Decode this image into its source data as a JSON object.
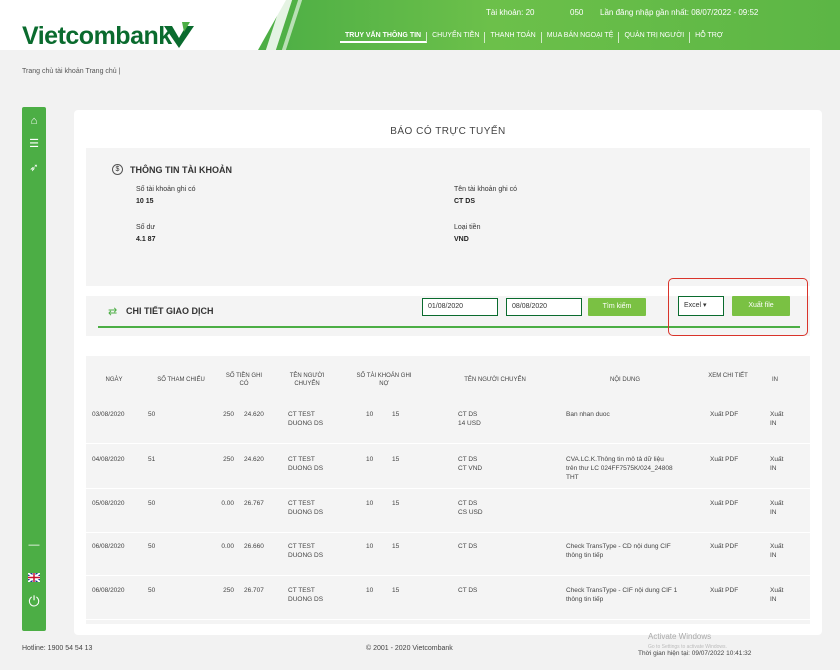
{
  "header": {
    "brand": "Vietcombank",
    "info": [
      "Tài khoản: 20",
      "050",
      "Lần đăng nhập gần nhất: 08/07/2022 - 09:52"
    ],
    "nav": [
      "TRUY VẤN THÔNG TIN",
      "CHUYỂN TIỀN",
      "THANH TOÁN",
      "MUA BÁN NGOẠI TỆ",
      "QUẢN TRỊ NGƯỜI",
      "HỖ TRỢ"
    ]
  },
  "breadcrumb": "Trang chủ tài khoản   Trang chủ |",
  "report_title": "BÁO CÓ TRỰC TUYẾN",
  "account": {
    "title": "THÔNG TIN TÀI KHOẢN",
    "fields": [
      {
        "label": "Số tài khoản ghi có",
        "value": "10          15"
      },
      {
        "label": "Tên tài khoản ghi có",
        "value": "CT                 DS"
      },
      {
        "label": "Số dư",
        "value": "4.1            87"
      },
      {
        "label": "Loại tiền",
        "value": "VND"
      }
    ]
  },
  "transactions": {
    "title": "CHI TIẾT GIAO DỊCH",
    "from_date": "01/08/2020",
    "to_date": "08/08/2020",
    "search_label": "Tìm kiếm",
    "export_format": "Excel ▾",
    "export_label": "Xuất file"
  },
  "table": {
    "headers": [
      "NGÀY",
      "SỐ THAM CHIẾU",
      "SỐ TIỀN GHI CÓ",
      "TÊN NGƯỜI CHUYỂN",
      "SỐ TÀI KHOẢN GHI NỢ",
      "TÊN NGƯỜI CHUYỂN",
      "NỘI DUNG",
      "XEM CHI TIẾT",
      "IN"
    ],
    "rows": [
      [
        "03/08/2020",
        "50",
        "250",
        "24.620",
        "CT TEST\nDUONG DS",
        "10",
        "15",
        "CT         DS\n14 USD",
        "Ban nhan duoc",
        "Xuất PDF",
        "Xuất\nIN"
      ],
      [
        "04/08/2020",
        "51",
        "250",
        "24.620",
        "CT TEST\nDUONG DS",
        "10",
        "15",
        "CT         DS\nCT VND",
        "CVA.LC.K.Thông tin mô tả dữ liệu\ntrên thư LC 024FF7575K/024_24808\nTHT",
        "Xuất PDF",
        "Xuất\nIN"
      ],
      [
        "05/08/2020",
        "50",
        "0.00",
        "26.767",
        "CT TEST\nDUONG DS",
        "10",
        "15",
        "CT         DS\nCS USD",
        "",
        "Xuất PDF",
        "Xuất\nIN"
      ],
      [
        "06/08/2020",
        "50",
        "0.00",
        "26.660",
        "CT TEST\nDUONG DS",
        "10",
        "15",
        "CT         DS",
        "Check TransType - CD nội dung CIF\nthông tin tiếp",
        "Xuất PDF",
        "Xuất\nIN"
      ],
      [
        "06/08/2020",
        "50",
        "250",
        "26.707",
        "CT TEST\nDUONG DS",
        "10",
        "15",
        "CT         DS",
        "Check TransType - CIF nội dung CIF 1\nthông tin tiếp",
        "Xuất PDF",
        "Xuất\nIN"
      ]
    ]
  },
  "footer": {
    "hotline": "Hotline: 1900 54 54 13",
    "copyright": "© 2001 - 2020 Vietcombank",
    "session": "Thời gian hiện tại: 09/07/2022 10:41:32"
  },
  "watermark": {
    "title": "Activate Windows",
    "sub": "Go to Settings to activate Windows."
  },
  "colors": {
    "brand": "#0a6b2e",
    "accent": "#4cae45",
    "button": "#7ac143",
    "highlight": "#d9342b"
  },
  "icons": [
    "home-icon",
    "list-icon",
    "send-icon",
    "minus-icon",
    "flag-uk-icon",
    "power-icon",
    "dollar-circle-icon",
    "transfer-icon"
  ]
}
